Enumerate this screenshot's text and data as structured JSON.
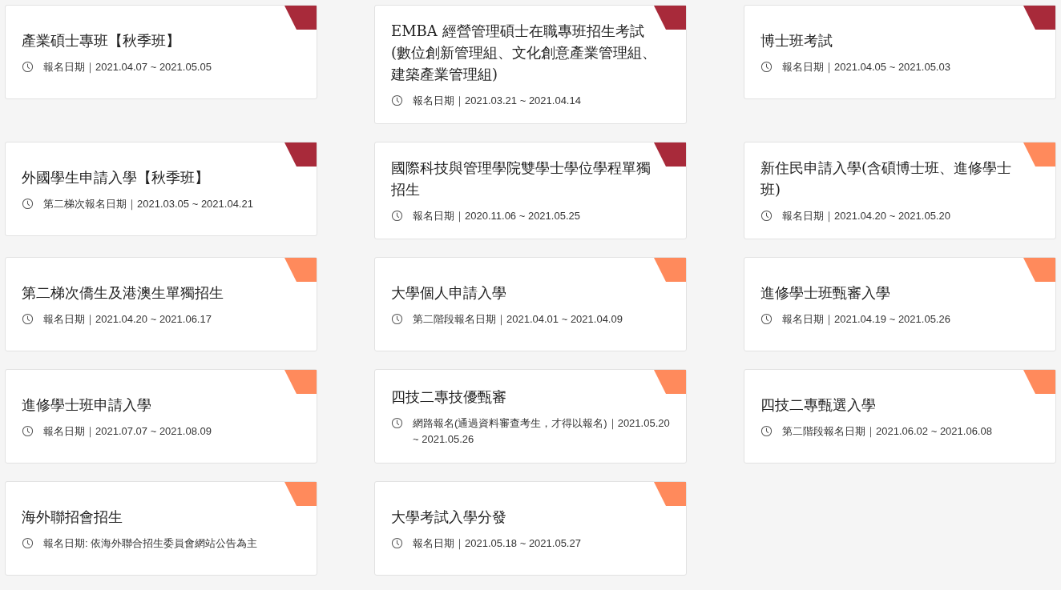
{
  "cards": [
    {
      "title": "產業碩士專班【秋季班】",
      "date": "報名日期｜2021.04.07 ~ 2021.05.05",
      "color": "#a82a3a"
    },
    {
      "title": "EMBA 經營管理碩士在職專班招生考試(數位創新管理組、文化創意產業管理組、建築產業管理組)",
      "date": "報名日期｜2021.03.21 ~ 2021.04.14",
      "color": "#a82a3a"
    },
    {
      "title": "博士班考試",
      "date": "報名日期｜2021.04.05 ~ 2021.05.03",
      "color": "#a82a3a"
    },
    {
      "title": "外國學生申請入學【秋季班】",
      "date": "第二梯次報名日期｜2021.03.05 ~ 2021.04.21",
      "color": "#a82a3a"
    },
    {
      "title": "國際科技與管理學院雙學士學位學程單獨招生",
      "date": "報名日期｜2020.11.06 ~ 2021.05.25",
      "color": "#a82a3a"
    },
    {
      "title": "新住民申請入學(含碩博士班、進修學士班)",
      "date": "報名日期｜2021.04.20 ~ 2021.05.20",
      "color": "#ff8a5c"
    },
    {
      "title": "第二梯次僑生及港澳生單獨招生",
      "date": "報名日期｜2021.04.20 ~ 2021.06.17",
      "color": "#ff8a5c"
    },
    {
      "title": "大學個人申請入學",
      "date": "第二階段報名日期｜2021.04.01 ~ 2021.04.09",
      "color": "#ff8a5c"
    },
    {
      "title": "進修學士班甄審入學",
      "date": "報名日期｜2021.04.19 ~ 2021.05.26",
      "color": "#ff8a5c"
    },
    {
      "title": "進修學士班申請入學",
      "date": "報名日期｜2021.07.07 ~ 2021.08.09",
      "color": "#ff8a5c"
    },
    {
      "title": "四技二專技優甄審",
      "date": "網路報名(通過資料審查考生，才得以報名)｜2021.05.20 ~ 2021.05.26",
      "color": "#ff8a5c"
    },
    {
      "title": "四技二專甄選入學",
      "date": "第二階段報名日期｜2021.06.02 ~ 2021.06.08",
      "color": "#ff8a5c"
    },
    {
      "title": "海外聯招會招生",
      "date": "報名日期: 依海外聯合招生委員會網站公告為主",
      "color": "#ff8a5c"
    },
    {
      "title": "大學考試入學分發",
      "date": "報名日期｜2021.05.18 ~ 2021.05.27",
      "color": "#ff8a5c"
    }
  ]
}
